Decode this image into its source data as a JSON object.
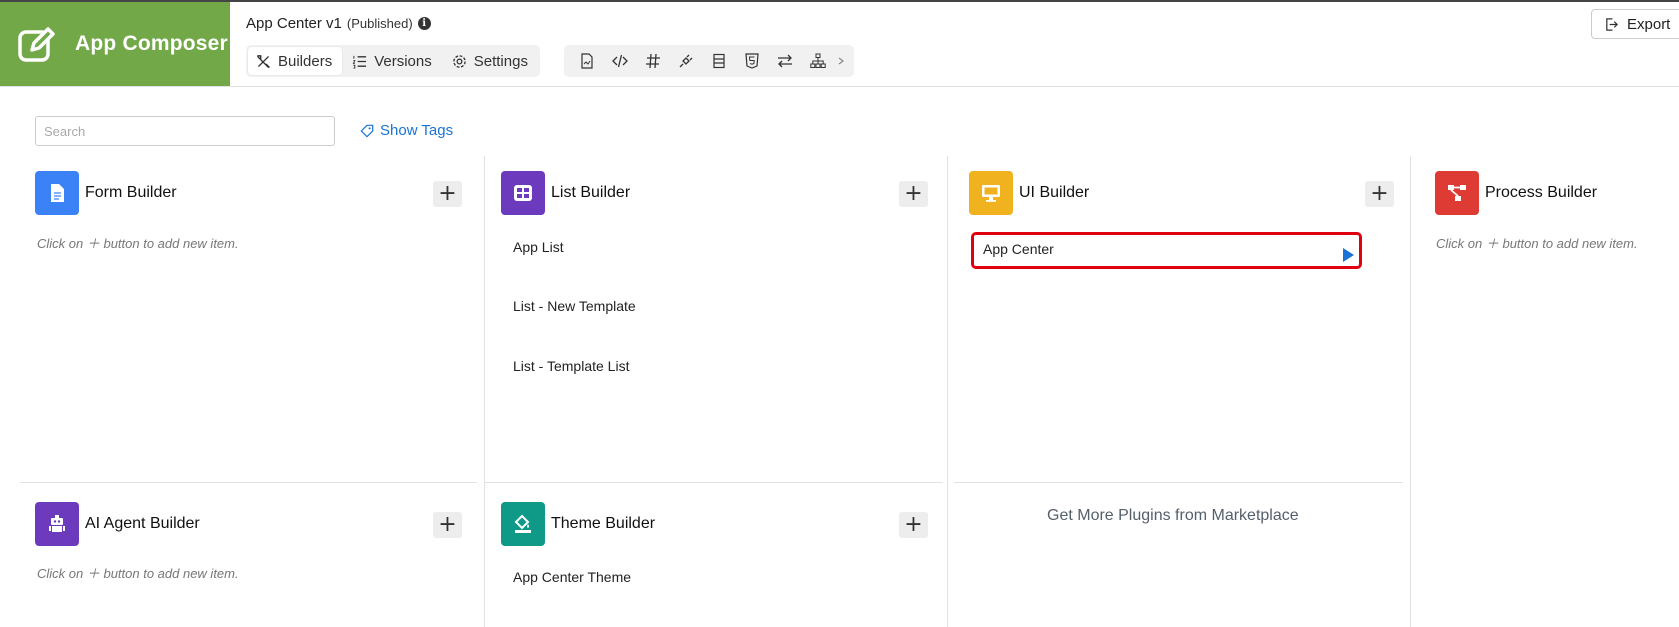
{
  "brand": {
    "title": "App Composer"
  },
  "app": {
    "name": "App Center v1",
    "status": "(Published)"
  },
  "nav": {
    "tabs": [
      {
        "label": "Builders"
      },
      {
        "label": "Versions"
      },
      {
        "label": "Settings"
      }
    ]
  },
  "toolbar_icons": [
    "document-icon",
    "code-icon",
    "hash-icon",
    "plugin-icon",
    "list-icon",
    "html5-icon",
    "swap-icon",
    "sitemap-icon",
    "chevron-right-icon"
  ],
  "export": {
    "label": "Export"
  },
  "search": {
    "placeholder": "Search"
  },
  "show_tags": {
    "label": "Show Tags"
  },
  "hint_text": "Click on ＋ button to add new item.",
  "builders": {
    "form": {
      "title": "Form Builder",
      "color": "#3b82f6"
    },
    "list": {
      "title": "List Builder",
      "color": "#6c3bbd",
      "items": [
        "App List",
        "List - New Template",
        "List - Template List"
      ]
    },
    "ui": {
      "title": "UI Builder",
      "color": "#f0b31f",
      "items": [
        "App Center"
      ]
    },
    "process": {
      "title": "Process Builder",
      "color": "#dd3b33"
    },
    "ai": {
      "title": "AI Agent Builder",
      "color": "#6c3bbd"
    },
    "theme": {
      "title": "Theme Builder",
      "color": "#0f9a87",
      "items": [
        "App Center Theme"
      ]
    }
  },
  "marketplace": {
    "label": "Get More Plugins from Marketplace"
  },
  "colors": {
    "brand_green": "#72a848",
    "link_blue": "#1a73d6",
    "selection_red": "#e0000f"
  }
}
